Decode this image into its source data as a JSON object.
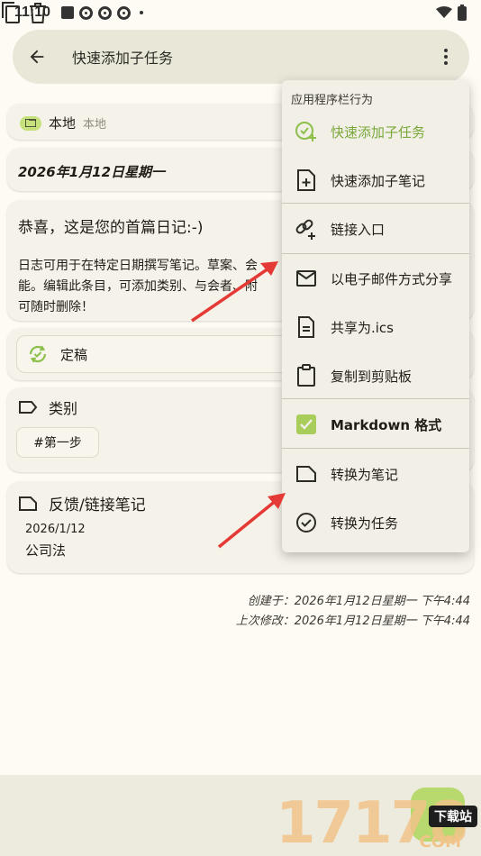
{
  "status_bar": {
    "time": "11:10"
  },
  "search_bar": {
    "title": "快速添加子任务"
  },
  "folder": {
    "label": "本地",
    "sublabel": "本地"
  },
  "entry": {
    "date_title": "2026年1月12日星期一",
    "title": "恭喜，这是您的首篇日记:-)",
    "body_lines": [
      "日志可用于在特定日期撰写笔记。草案、会",
      "能。编辑此条目，可添加类别、与会者、附",
      "可随时删除！"
    ],
    "status": "定稿"
  },
  "categories": {
    "header": "类别",
    "tag": "#第一步"
  },
  "linked": {
    "header": "反馈/链接笔记",
    "date": "2026/1/12",
    "name": "公司法"
  },
  "meta": {
    "created": "创建于：2026年1月12日星期一 下午4:44",
    "modified": "上次修改：2026年1月12日星期一 下午4:44"
  },
  "menu": {
    "heading": "应用程序栏行为",
    "items": [
      {
        "label": "快速添加子任务",
        "icon": "check-add-icon",
        "active": true
      },
      {
        "label": "快速添加子笔记",
        "icon": "note-add-icon"
      },
      {
        "label": "链接入口",
        "icon": "link-add-icon"
      },
      {
        "label": "以电子邮件方式分享",
        "icon": "mail-icon"
      },
      {
        "label": "共享为.ics",
        "icon": "file-icon"
      },
      {
        "label": "复制到剪贴板",
        "icon": "clipboard-icon"
      },
      {
        "label": "Markdown 格式",
        "icon": "checkbox-icon",
        "checked": true
      },
      {
        "label": "转换为笔记",
        "icon": "note-icon"
      },
      {
        "label": "转换为任务",
        "icon": "task-icon"
      }
    ]
  },
  "watermark": {
    "text": "17178",
    "label": "下载站",
    "domain": "COM"
  },
  "colors": {
    "accent": "#b8d96e",
    "background": "#fdfbf3",
    "menu_bg": "#f1efe6",
    "arrow": "#e53935"
  }
}
